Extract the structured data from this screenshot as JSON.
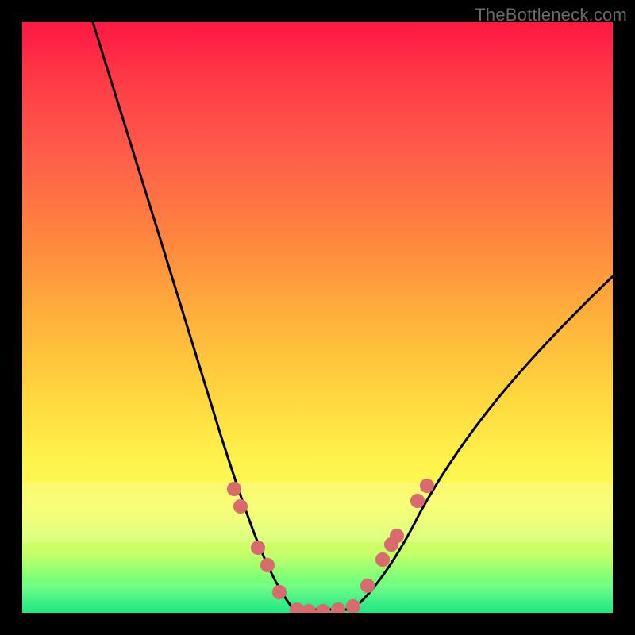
{
  "watermark": "TheBottleneck.com",
  "chart_data": {
    "type": "line",
    "title": "",
    "xlabel": "",
    "ylabel": "",
    "xlim": [
      0,
      100
    ],
    "ylim": [
      0,
      100
    ],
    "grid": false,
    "series": [
      {
        "name": "curve-left",
        "x": [
          12,
          15,
          18,
          22,
          26,
          30,
          33,
          36,
          38,
          40,
          42,
          44,
          46
        ],
        "y": [
          100,
          87,
          74,
          60,
          47,
          35,
          27,
          20,
          14,
          9,
          5,
          1,
          0
        ]
      },
      {
        "name": "curve-bottom",
        "x": [
          46,
          48,
          50,
          52,
          54,
          56
        ],
        "y": [
          0,
          0,
          0,
          0,
          0,
          0
        ]
      },
      {
        "name": "curve-right",
        "x": [
          56,
          58,
          60,
          63,
          67,
          72,
          78,
          85,
          92,
          100
        ],
        "y": [
          0,
          2,
          5,
          10,
          17,
          25,
          33,
          41,
          49,
          57
        ]
      }
    ],
    "scatter": [
      {
        "name": "left-dot-1",
        "x": 36.0,
        "y": 21.0
      },
      {
        "name": "left-dot-2",
        "x": 37.0,
        "y": 18.0
      },
      {
        "name": "left-dot-3",
        "x": 40.0,
        "y": 11.0
      },
      {
        "name": "left-dot-4",
        "x": 41.5,
        "y": 8.0
      },
      {
        "name": "left-dot-5",
        "x": 43.5,
        "y": 3.5
      },
      {
        "name": "bottom-dot-1",
        "x": 46.5,
        "y": 0.5
      },
      {
        "name": "bottom-dot-2",
        "x": 48.5,
        "y": 0.3
      },
      {
        "name": "bottom-dot-3",
        "x": 51.0,
        "y": 0.3
      },
      {
        "name": "bottom-dot-4",
        "x": 53.5,
        "y": 0.5
      },
      {
        "name": "bottom-dot-5",
        "x": 56.0,
        "y": 1.0
      },
      {
        "name": "right-dot-1",
        "x": 58.5,
        "y": 4.5
      },
      {
        "name": "right-dot-2",
        "x": 61.0,
        "y": 9.0
      },
      {
        "name": "right-dot-3",
        "x": 62.5,
        "y": 11.5
      },
      {
        "name": "right-dot-4",
        "x": 63.5,
        "y": 13.0
      },
      {
        "name": "right-dot-5",
        "x": 67.0,
        "y": 19.0
      },
      {
        "name": "right-dot-6",
        "x": 68.5,
        "y": 21.5
      }
    ],
    "bands": [
      {
        "name": "haze-upper",
        "y_top": 22,
        "y_bottom": 12
      },
      {
        "name": "haze-lower",
        "y_top": 5,
        "y_bottom": 0
      }
    ]
  }
}
